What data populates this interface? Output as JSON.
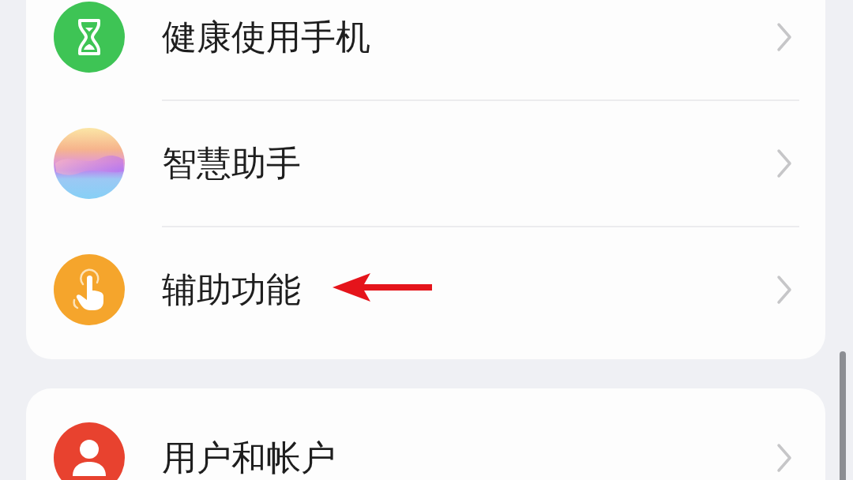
{
  "groups": [
    {
      "items": [
        {
          "label": "健康使用手机",
          "marked": false
        },
        {
          "label": "智慧助手",
          "marked": false
        },
        {
          "label": "辅助功能",
          "marked": true
        }
      ]
    },
    {
      "items": [
        {
          "label": "用户和帐户",
          "marked": false
        }
      ]
    }
  ]
}
